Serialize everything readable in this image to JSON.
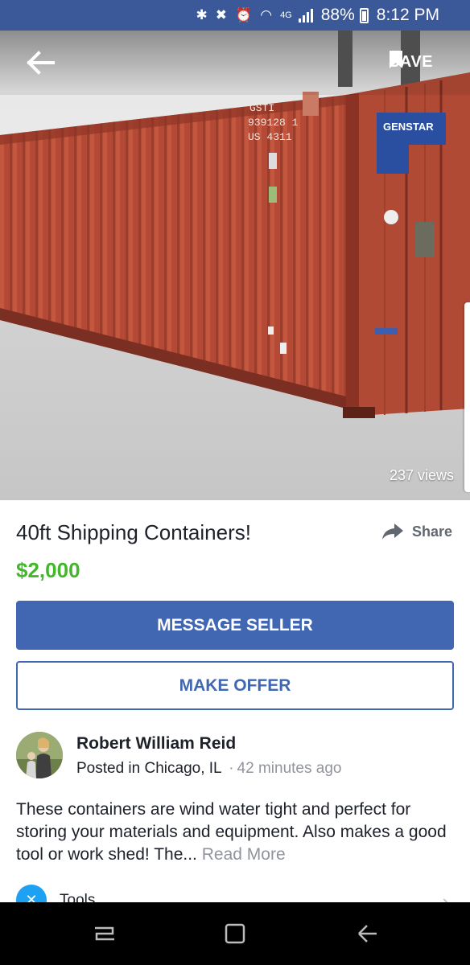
{
  "status_bar": {
    "network": "4G",
    "battery": "88%",
    "time": "8:12 PM"
  },
  "photo": {
    "save_label": "SAVE",
    "views": "237 views",
    "container_markings": [
      "GSTI",
      "939128 1",
      "US 4311"
    ],
    "door_logo": "GENSTAR"
  },
  "listing": {
    "title": "40ft Shipping Containers!",
    "share_label": "Share",
    "price": "$2,000"
  },
  "actions": {
    "message_seller": "MESSAGE SELLER",
    "make_offer": "MAKE OFFER"
  },
  "seller": {
    "name": "Robert William Reid",
    "posted_prefix": "Posted in",
    "location": "Chicago, IL",
    "separator": "·",
    "time_ago": "42 minutes ago"
  },
  "description": {
    "text": "These containers are wind water tight and perfect for storing your materials and equipment. Also makes a good tool or work shed! The...",
    "read_more": "Read More"
  },
  "category": {
    "label": "Tools",
    "icon": "tools-icon"
  },
  "colors": {
    "status_bar": "#3b5998",
    "primary_button": "#4267b2",
    "price_green": "#42b72a",
    "nav_bar": "#000000"
  }
}
